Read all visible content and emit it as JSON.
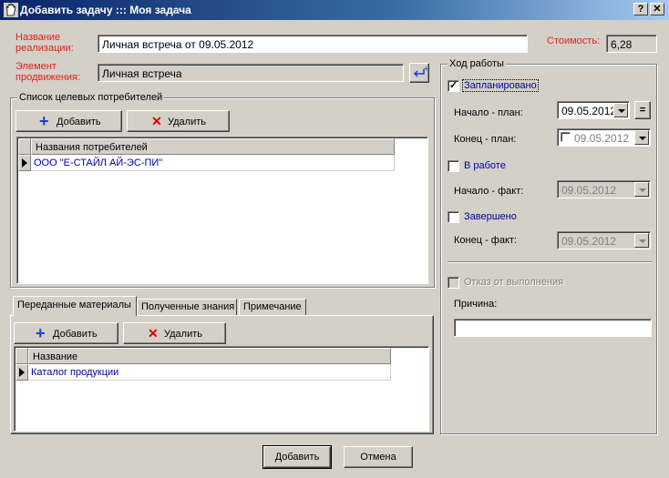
{
  "window": {
    "title": "Добавить задачу ::: Моя задача",
    "help_btn": "?",
    "close_btn": "✕"
  },
  "form": {
    "impl_name_label": "Название реализации:",
    "impl_name_value": "Личная встреча от 09.05.2012",
    "promo_label": "Элемент продвижения:",
    "promo_value": "Личная встреча",
    "cost_label": "Стоимость:",
    "cost_value": "6,28"
  },
  "consumers": {
    "group_title": "Список целевых потребителей",
    "add_label": "Добавить",
    "delete_label": "Удалить",
    "column_header": "Названия потребителей",
    "rows": [
      "ООО \"Е-СТАЙЛ АЙ-ЭС-ПИ\""
    ]
  },
  "tabs": {
    "items": [
      "Переданные материалы",
      "Полученные знания",
      "Примечание"
    ],
    "active": 0,
    "add_label": "Добавить",
    "delete_label": "Удалить",
    "column_header": "Название",
    "rows": [
      "Каталог продукции"
    ]
  },
  "progress": {
    "group_title": "Ход работы",
    "planned_label": "Запланировано",
    "planned_checked": true,
    "start_plan_label": "Начало - план:",
    "start_plan_value": "09.05.2012",
    "eq_btn": "=",
    "end_plan_label": "Конец - план:",
    "end_plan_value": "09.05.2012",
    "in_work_label": "В работе",
    "start_fact_label": "Начало - факт:",
    "start_fact_value": "09.05.2012",
    "done_label": "Завершено",
    "end_fact_label": "Конец - факт:",
    "end_fact_value": "09.05.2012",
    "refusal_label": "Отказ от выполнения",
    "reason_label": "Причина:",
    "reason_value": ""
  },
  "footer": {
    "ok_label": "Добавить",
    "cancel_label": "Отмена"
  },
  "colors": {
    "title_start": "#0a246a",
    "label_red": "#e02020",
    "link_blue": "#0000a0",
    "face": "#d4d0c8"
  }
}
